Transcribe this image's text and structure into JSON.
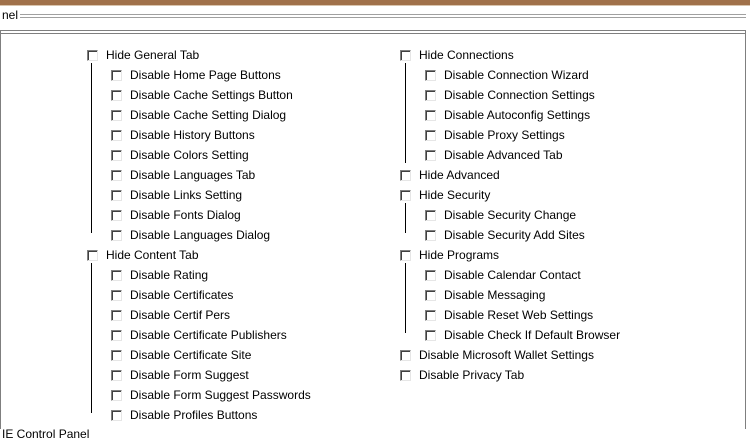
{
  "panel": {
    "legend": "nel",
    "footer": "IE Control Panel"
  },
  "left": {
    "general": {
      "label": "Hide General Tab",
      "items": [
        "Disable Home Page Buttons",
        "Disable Cache Settings Button",
        "Disable Cache Setting Dialog",
        "Disable History Buttons",
        "Disable Colors Setting",
        "Disable Languages Tab",
        "Disable Links Setting",
        "Disable Fonts Dialog",
        "Disable Languages Dialog"
      ]
    },
    "content": {
      "label": "Hide Content Tab",
      "items": [
        "Disable Rating",
        "Disable Certificates",
        "Disable Certif Pers",
        "Disable Certificate Publishers",
        "Disable Certificate Site",
        "Disable Form Suggest",
        "Disable Form Suggest Passwords",
        "Disable Profiles Buttons"
      ]
    }
  },
  "right": {
    "connections": {
      "label": "Hide Connections",
      "items": [
        "Disable Connection Wizard",
        "Disable Connection Settings",
        "Disable Autoconfig Settings",
        "Disable Proxy Settings",
        "Disable Advanced Tab"
      ]
    },
    "advanced": {
      "label": "Hide Advanced"
    },
    "security": {
      "label": "Hide Security",
      "items": [
        "Disable Security Change",
        "Disable Security Add Sites"
      ]
    },
    "programs": {
      "label": "Hide Programs",
      "items": [
        "Disable Calendar Contact",
        "Disable Messaging",
        "Disable Reset Web Settings",
        "Disable Check If Default Browser"
      ]
    },
    "wallet": {
      "label": "Disable Microsoft Wallet Settings"
    },
    "privacy": {
      "label": "Disable Privacy Tab"
    }
  }
}
